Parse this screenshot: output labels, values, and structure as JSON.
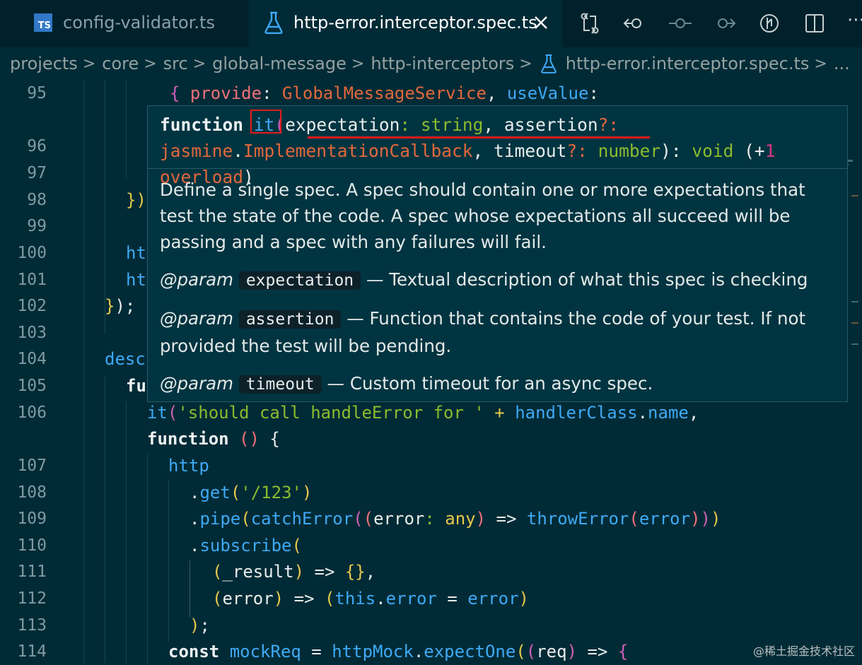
{
  "tabs": [
    {
      "label": "config-validator.ts",
      "icon": "typescript-file-icon",
      "icon_text": "TS",
      "active": false
    },
    {
      "label": "http-error.interceptor.spec.ts",
      "icon": "flask-icon",
      "active": true
    }
  ],
  "breadcrumb": [
    "projects",
    "core",
    "src",
    "global-message",
    "http-interceptors",
    "http-error.interceptor.spec.ts",
    "..."
  ],
  "line_numbers": [
    "95",
    "96",
    "97",
    "98",
    "99",
    "100",
    "101",
    "102",
    "103",
    "104",
    "105",
    "106",
    "107",
    "108",
    "109",
    "110",
    "111",
    "112",
    "113",
    "114"
  ],
  "code": {
    "l95": [
      "{ ",
      "provide",
      ": ",
      "GlobalMessageService",
      ", ",
      "useValue",
      ":"
    ],
    "l98": "})",
    "l100": "ht",
    "l101": "ht",
    "l102": [
      "}",
      ");"
    ],
    "l104": "desc",
    "l105": "fu",
    "l106": [
      "it",
      "(",
      "'should call handleError for '",
      " + ",
      "handlerClass",
      ".",
      "name",
      ","
    ],
    "l106b": [
      "function",
      " ",
      "()",
      " {"
    ],
    "l107": "http",
    "l108": [
      ".",
      "get",
      "(",
      "'/123'",
      ")"
    ],
    "l109": [
      ".",
      "pipe",
      "(",
      "catchError",
      "(",
      "(",
      "error",
      ": ",
      "any",
      ")",
      " => ",
      "throwError",
      "(",
      "error",
      ")",
      ")",
      ")"
    ],
    "l110": [
      ".",
      "subscribe",
      "("
    ],
    "l111": [
      "(",
      "_result",
      ")",
      " => ",
      "{}",
      ","
    ],
    "l112": [
      "(",
      "error",
      ")",
      " => ",
      "(",
      "this",
      ".",
      "error",
      " = ",
      "error",
      ")"
    ],
    "l113": [
      ")",
      ";"
    ],
    "l114": [
      "const",
      " ",
      "mockReq",
      " = ",
      "httpMock",
      ".",
      "expectOne",
      "(",
      "(",
      "req",
      ")",
      " => ",
      "{"
    ]
  },
  "hover": {
    "signature": {
      "keyword": "function",
      "name": "it",
      "open": "(",
      "p1": "expectation",
      "c1": ": ",
      "t1": "string",
      "comma1": ", ",
      "p2": "assertion",
      "q2": "?: ",
      "ns": "jasmine",
      "dot": ".",
      "t2": "ImplementationCallback",
      "comma2": ", ",
      "p3": "timeout",
      "q3": "?: ",
      "t3": "number",
      "close": "): ",
      "ret": "void",
      "ov_open": " (+",
      "ov_num": "1",
      "ov_word": " overload",
      "ov_close": ")"
    },
    "description": "Define a single spec. A spec should contain one or more expectations that test the state of the code. A spec whose expectations all succeed will be passing and a spec with any failures will fail.",
    "params": [
      {
        "tag": "@param",
        "name": "expectation",
        "text": " — Textual description of what this spec is checking"
      },
      {
        "tag": "@param",
        "name": "assertion",
        "text": " — Function that contains the code of your test. If not provided the test will be pending."
      },
      {
        "tag": "@param",
        "name": "timeout",
        "text": " — Custom timeout for an async spec."
      }
    ]
  },
  "toolbar_icons": [
    "compare-changes-icon",
    "go-back-icon",
    "go-forward-circle-icon",
    "go-forward-icon",
    "timeline-icon",
    "split-editor-icon",
    "more-actions-icon"
  ],
  "more_label": "···",
  "watermark": "@稀土掘金技术社区",
  "colors": {
    "background": "#002b36",
    "tabbar": "#00212b",
    "hover_bg": "#003440",
    "highlight": "#e21b1b"
  }
}
